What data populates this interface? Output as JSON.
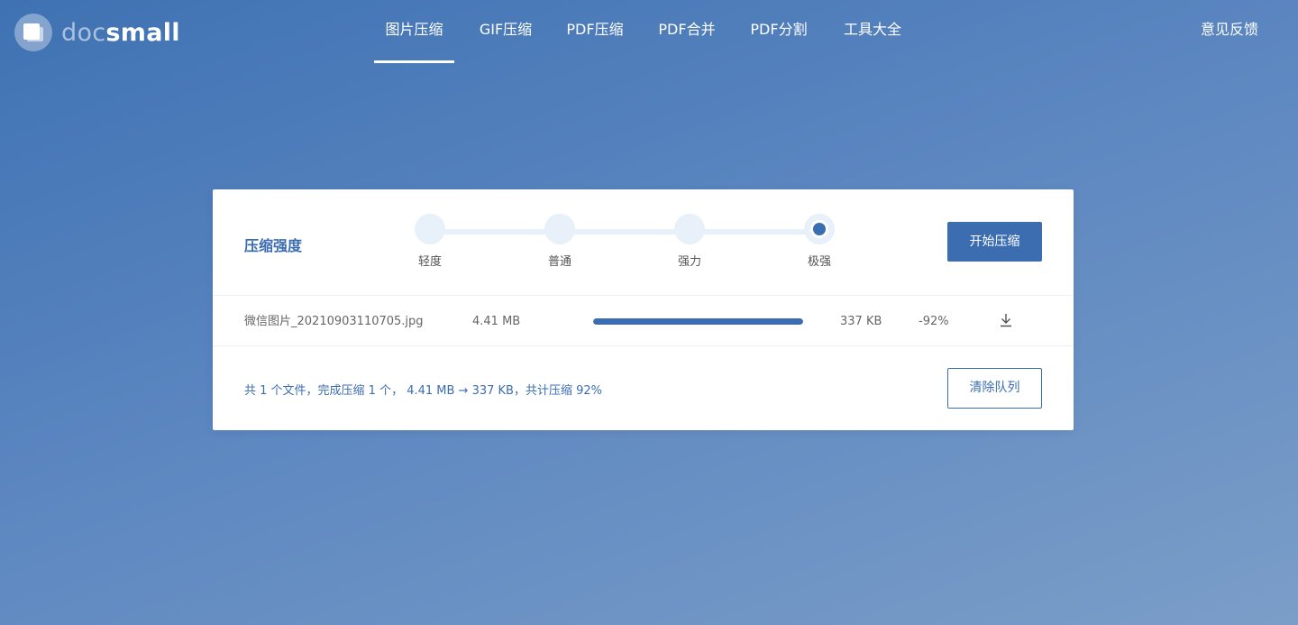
{
  "logo": {
    "icon": "docsmall-logo-icon",
    "text_doc": "doc",
    "text_small": "small"
  },
  "nav": {
    "items": [
      {
        "label": "图片压缩",
        "active": true
      },
      {
        "label": "GIF压缩",
        "active": false
      },
      {
        "label": "PDF压缩",
        "active": false
      },
      {
        "label": "PDF合并",
        "active": false
      },
      {
        "label": "PDF分割",
        "active": false
      },
      {
        "label": "工具大全",
        "active": false
      }
    ],
    "feedback": "意见反馈"
  },
  "compression": {
    "label": "压缩强度",
    "levels": [
      "轻度",
      "普通",
      "强力",
      "极强"
    ],
    "selected_index": 3,
    "start_button": "开始压缩"
  },
  "file": {
    "name": "微信图片_20210903110705.jpg",
    "original_size": "4.41 MB",
    "progress": 1.0,
    "compressed_size": "337 KB",
    "ratio": "-92%",
    "download_icon": "download-icon"
  },
  "summary": {
    "text": "共 1 个文件，完成压缩 1 个， 4.41 MB → 337 KB，共计压缩 92%",
    "clear_button": "清除队列"
  },
  "colors": {
    "accent": "#3b6db0",
    "track": "#e8f0fa"
  }
}
